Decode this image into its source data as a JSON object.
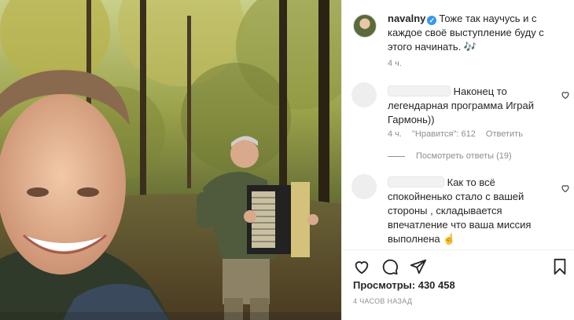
{
  "post": {
    "username": "navalny",
    "caption": "Тоже так научусь и с каждое своё выступление буду с этого начинать. 🎶",
    "time": "4 ч.",
    "views_label": "Просмотры:",
    "views_count": "430 458",
    "time_ago": "4 ЧАСОВ НАЗАД"
  },
  "comments": [
    {
      "text": "Наконец то легендарная программа Играй Гармонь))",
      "time": "4 ч.",
      "likes": "\"Нравится\": 612",
      "reply_label": "Ответить",
      "view_replies": "Посмотреть ответы (19)"
    },
    {
      "text": "Как то всё спокойненько стало с вашей стороны , складывается впечатление что ваша миссия выполнена ☝"
    }
  ],
  "icons": {
    "like": "heart-icon",
    "comment": "comment-icon",
    "share": "paper-plane-icon",
    "save": "bookmark-icon",
    "verified": "verified-badge-icon"
  },
  "colors": {
    "verified": "#3897f0",
    "muted": "#8e8e8e",
    "text": "#262626"
  }
}
